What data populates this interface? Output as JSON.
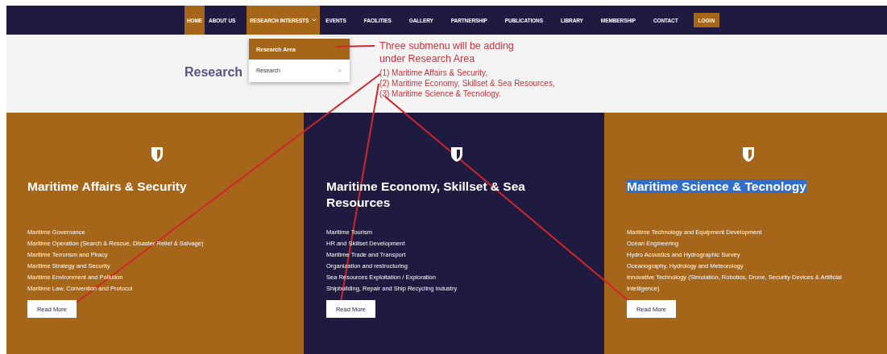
{
  "nav": [
    {
      "label": "HOME",
      "highlighted": true,
      "kind": "link"
    },
    {
      "label": "ABOUT US",
      "highlighted": false,
      "kind": "link"
    },
    {
      "label": "RESEARCH INTERESTS",
      "highlighted": true,
      "kind": "dropdown"
    },
    {
      "label": "EVENTS",
      "highlighted": false,
      "kind": "link"
    },
    {
      "label": "FACILITIES",
      "highlighted": false,
      "kind": "link"
    },
    {
      "label": "GALLERY",
      "highlighted": false,
      "kind": "link"
    },
    {
      "label": "PARTNERSHIP",
      "highlighted": false,
      "kind": "link"
    },
    {
      "label": "PUBLICATIONS",
      "highlighted": false,
      "kind": "link"
    },
    {
      "label": "LIBRARY",
      "highlighted": false,
      "kind": "link"
    },
    {
      "label": "MEMBERSHIP",
      "highlighted": false,
      "kind": "link"
    },
    {
      "label": "CONTACT",
      "highlighted": false,
      "kind": "link"
    },
    {
      "label": "LOGIN",
      "highlighted": true,
      "kind": "button"
    }
  ],
  "dropdown": [
    {
      "label": "Research Area",
      "selected": true,
      "has_submenu": false
    },
    {
      "label": "Research",
      "selected": false,
      "has_submenu": true
    }
  ],
  "submenu_arrow": ">",
  "heading": "Research",
  "annotation": {
    "lines": [
      "Three submenu will be adding",
      "under Research Area"
    ],
    "items": [
      "(1) Maritime Affairs & Security,",
      "(2) Maritime Economy, Skillset & Sea Resources,",
      "(3) Maritime Science & Tecnology."
    ]
  },
  "cards": [
    {
      "title": "Maritime Affairs & Security",
      "color": "#a5661a",
      "highlighted": false,
      "items": [
        "Maritime Governance",
        "Maritime Operation (Search & Rescue, Disaster Relief & Salvage)",
        "Maritime Terrorism and Piracy",
        "Maritime Strategy and Security",
        "Maritime Environment and Pollution",
        "Maritime Law, Convention and Protocol"
      ],
      "button": "Read More"
    },
    {
      "title": "Maritime Economy, Skillset & Sea Resources",
      "color": "#1e1a40",
      "highlighted": false,
      "items": [
        "Maritime Tourism",
        "HR and Skillset Development",
        "Maritime Trade and Transport",
        "Organization and restructuring",
        "Sea Resources Exploitation / Exploration",
        "Shipbuilding, Repair and Ship Recycling Industry"
      ],
      "button": "Read More"
    },
    {
      "title": "Maritime Science & Tecnology",
      "color": "#a5661a",
      "highlighted": true,
      "items": [
        "Maritime Technology and Equipment Development",
        "Ocean Engineering",
        "Hydro Acoustics and Hydrographic Survey",
        "Oceanography, Hydrology and Meteorology",
        "Innovative Technology (Simulation, Robotics, Drone, Security Devices & Artificial Intelligence)"
      ],
      "button": "Read More"
    }
  ]
}
